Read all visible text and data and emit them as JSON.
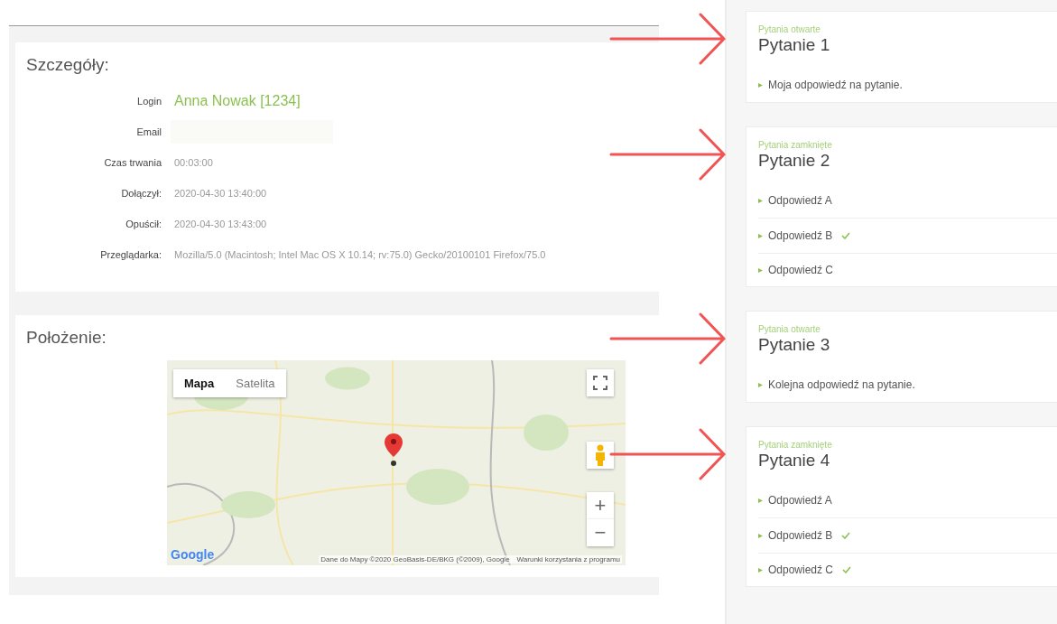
{
  "details": {
    "title": "Szczegóły:",
    "fields": [
      {
        "label": "Login",
        "value": "Anna Nowak [1234]",
        "kind": "link"
      },
      {
        "label": "Email",
        "kind": "redacted"
      },
      {
        "label": "Czas trwania",
        "value": "00:03:00",
        "kind": "text"
      },
      {
        "label": "Dołączył:",
        "value": "2020-04-30 13:40:00",
        "kind": "text"
      },
      {
        "label": "Opuścił:",
        "value": "2020-04-30 13:43:00",
        "kind": "text"
      },
      {
        "label": "Przeglądarka:",
        "value": "Mozilla/5.0 (Macintosh; Intel Mac OS X 10.14; rv:75.0) Gecko/20100101 Firefox/75.0",
        "kind": "text"
      }
    ]
  },
  "location": {
    "title": "Położenie:",
    "map": {
      "map_types": [
        {
          "label": "Mapa",
          "selected": true
        },
        {
          "label": "Satelita",
          "selected": false
        }
      ],
      "zoom_in": "+",
      "zoom_out": "−",
      "logo": "Google",
      "attribution": "Dane do Mapy ©2020 GeoBasis-DE/BKG (©2009), Google",
      "terms": "Warunki korzystania z programu"
    }
  },
  "questions": [
    {
      "category": "Pytania otwarte",
      "title": "Pytanie 1",
      "answers": [
        {
          "text": "Moja odpowiedź na pytanie."
        }
      ]
    },
    {
      "category": "Pytania zamknięte",
      "title": "Pytanie 2",
      "answers": [
        {
          "text": "Odpowiedź A",
          "checked": false
        },
        {
          "text": "Odpowiedź B",
          "checked": true
        },
        {
          "text": "Odpowiedź C",
          "checked": false
        }
      ]
    },
    {
      "category": "Pytania otwarte",
      "title": "Pytanie 3",
      "answers": [
        {
          "text": "Kolejna odpowiedź na pytanie."
        }
      ]
    },
    {
      "category": "Pytania zamknięte",
      "title": "Pytanie 4",
      "answers": [
        {
          "text": "Odpowiedź A",
          "checked": false
        },
        {
          "text": "Odpowiedź B",
          "checked": true
        },
        {
          "text": "Odpowiedź C",
          "checked": true
        }
      ]
    }
  ]
}
